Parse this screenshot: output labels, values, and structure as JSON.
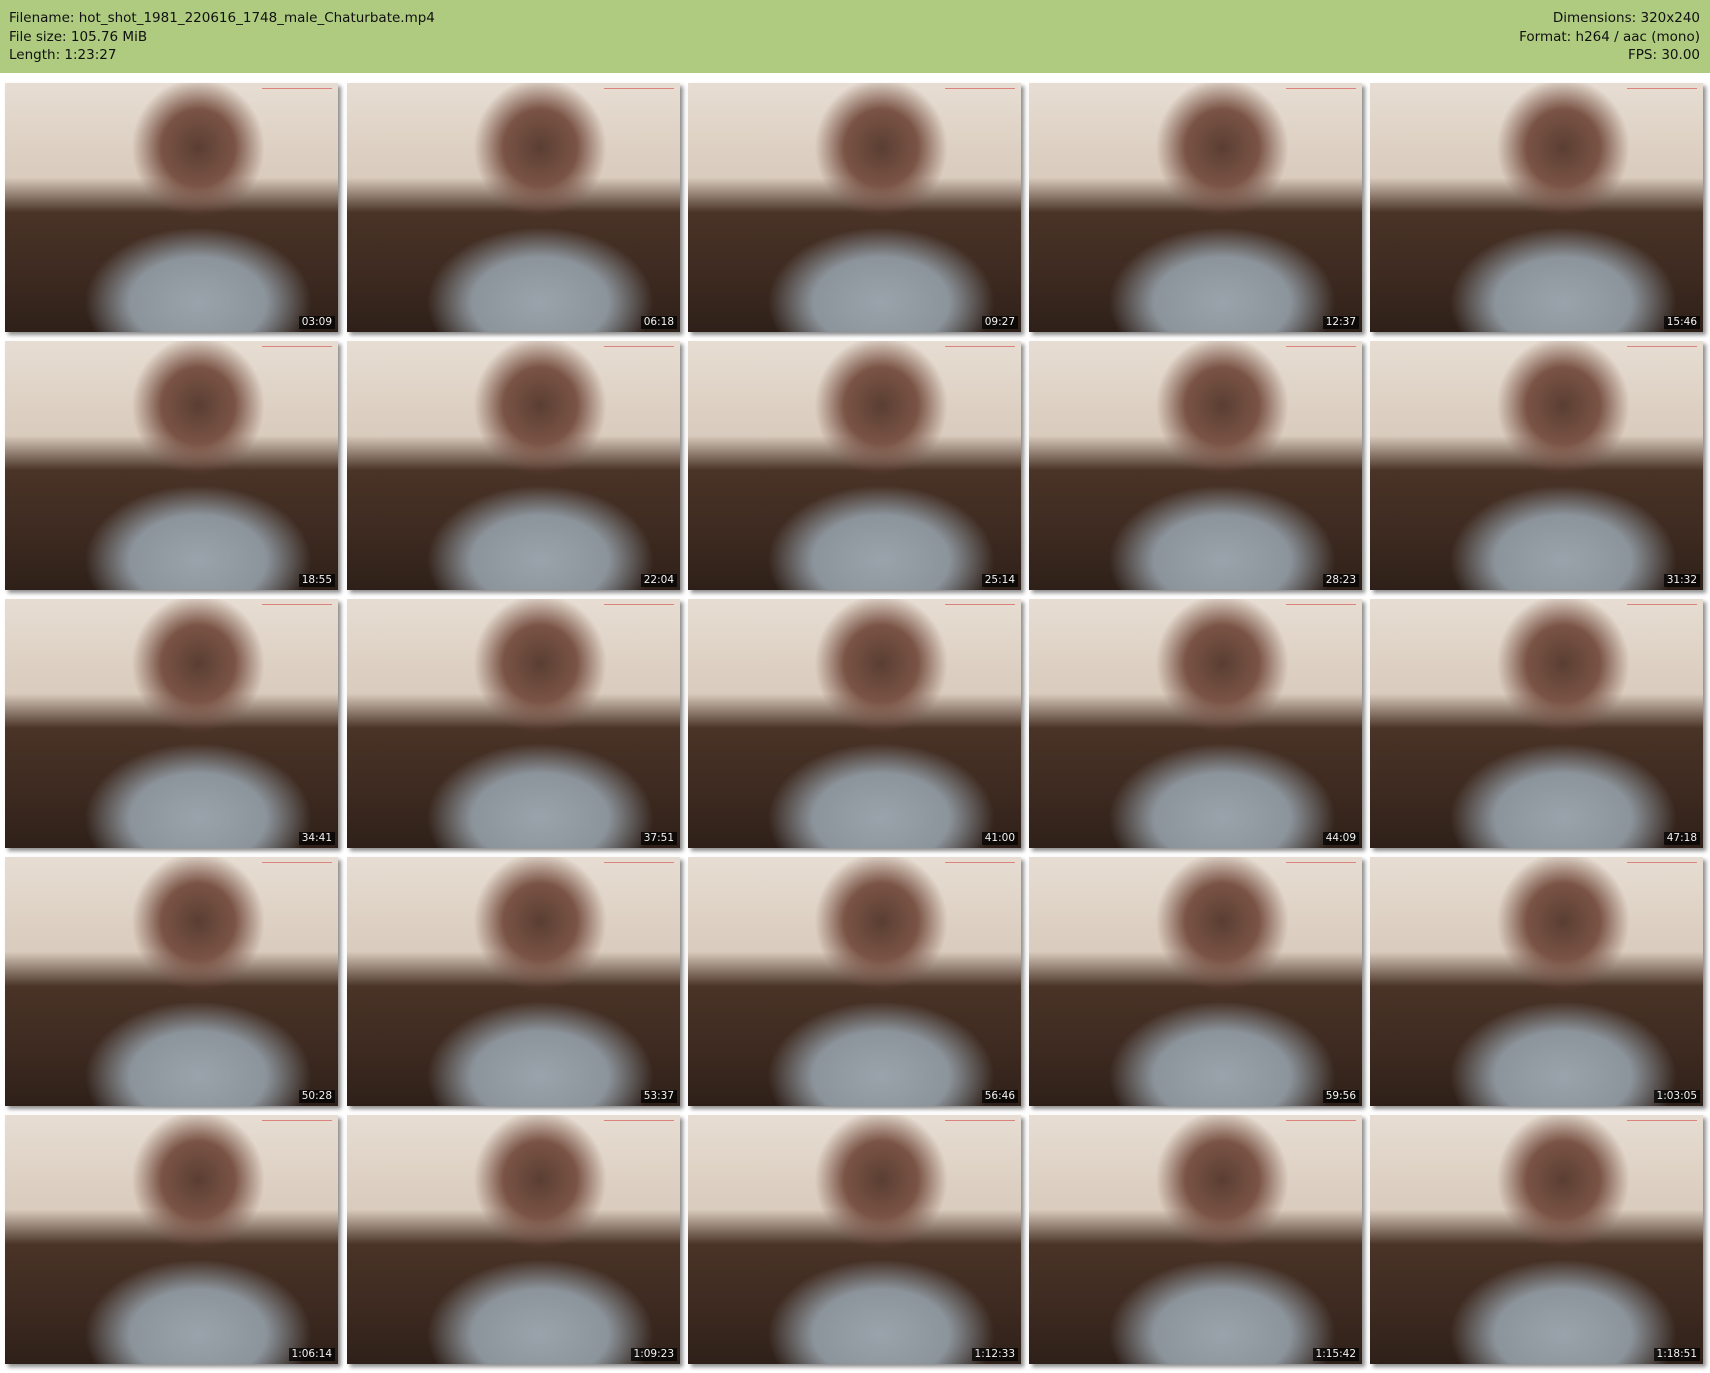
{
  "header": {
    "filename": "Filename: hot_shot_1981_220616_1748_male_Chaturbate.mp4",
    "filesize": "File size: 105.76 MiB",
    "length": "Length: 1:23:27",
    "dimensions": "Dimensions: 320x240",
    "format": "Format: h264 / aac (mono)",
    "fps": "FPS: 30.00",
    "background_color": "#aecb80"
  },
  "thumbnails": [
    {
      "timestamp": "03:09"
    },
    {
      "timestamp": "06:18"
    },
    {
      "timestamp": "09:27"
    },
    {
      "timestamp": "12:37"
    },
    {
      "timestamp": "15:46"
    },
    {
      "timestamp": "18:55"
    },
    {
      "timestamp": "22:04"
    },
    {
      "timestamp": "25:14"
    },
    {
      "timestamp": "28:23"
    },
    {
      "timestamp": "31:32"
    },
    {
      "timestamp": "34:41"
    },
    {
      "timestamp": "37:51"
    },
    {
      "timestamp": "41:00"
    },
    {
      "timestamp": "44:09"
    },
    {
      "timestamp": "47:18"
    },
    {
      "timestamp": "50:28"
    },
    {
      "timestamp": "53:37"
    },
    {
      "timestamp": "56:46"
    },
    {
      "timestamp": "59:56"
    },
    {
      "timestamp": "1:03:05"
    },
    {
      "timestamp": "1:06:14"
    },
    {
      "timestamp": "1:09:23"
    },
    {
      "timestamp": "1:12:33"
    },
    {
      "timestamp": "1:15:42"
    },
    {
      "timestamp": "1:18:51"
    }
  ]
}
